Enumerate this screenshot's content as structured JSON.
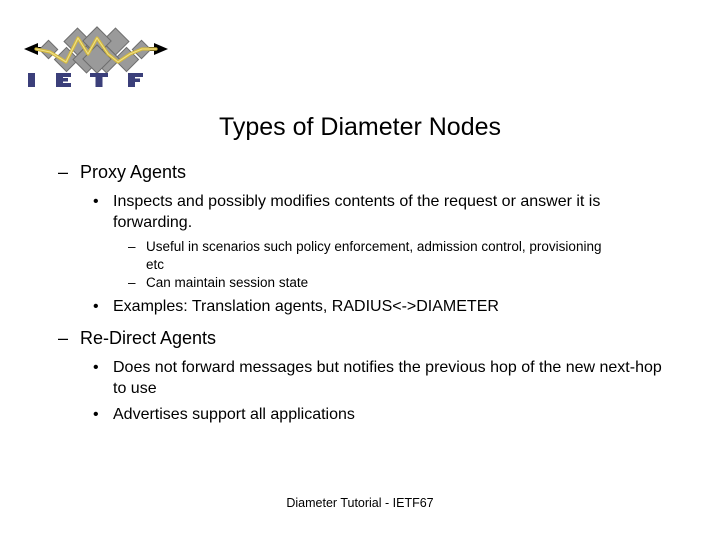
{
  "slide": {
    "title": "Types of Diameter Nodes",
    "footer": "Diameter Tutorial - IETF67",
    "background_color": "#ffffff",
    "text_color": "#000000"
  },
  "logo": {
    "name": "ietf-logo",
    "wordmark": "IETF",
    "letters": [
      "I",
      "E",
      "T",
      "F"
    ],
    "diamond_color": "#9a9a9a",
    "diamond_edge_color": "#6d6d6d",
    "zigzag_color": "#d4b93c",
    "arrow_color": "#000000",
    "wordmark_color": "#3b3f7a"
  },
  "outline": {
    "markers": {
      "level1": "–",
      "level2": "•",
      "level3": "–"
    },
    "items": [
      {
        "level": 1,
        "text": "Proxy Agents"
      },
      {
        "level": 2,
        "text": "Inspects and possibly modifies contents of the request or answer it is forwarding."
      },
      {
        "level": 3,
        "text": "Useful in scenarios such policy enforcement, admission control, provisioning etc"
      },
      {
        "level": 3,
        "text": "Can maintain session state"
      },
      {
        "level": 2,
        "text": "Examples: Translation agents, RADIUS<->DIAMETER"
      },
      {
        "level": 1,
        "text": "Re-Direct Agents"
      },
      {
        "level": 2,
        "text": "Does not forward messages but notifies the previous hop of the new next-hop to use"
      },
      {
        "level": 2,
        "text": "Advertises support all applications"
      }
    ]
  }
}
